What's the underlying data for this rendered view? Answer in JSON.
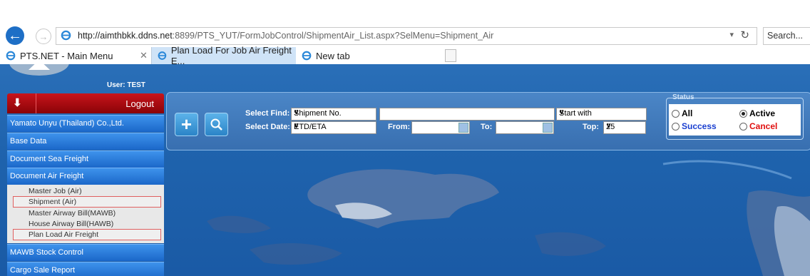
{
  "browser": {
    "url_host": "http://aimthbkk.ddns.net",
    "url_rest": ":8899/PTS_YUT/FormJobControl/ShipmentAir_List.aspx?SelMenu=Shipment_Air",
    "search_placeholder": "Search...",
    "tabs": [
      {
        "label": "PTS.NET - Main Menu"
      },
      {
        "label": "Plan Load For Job Air Freight E..."
      },
      {
        "label": "New tab"
      }
    ]
  },
  "header": {
    "user": "User: TEST"
  },
  "sidebar": {
    "logout": "Logout",
    "items": [
      {
        "label": "Yamato Unyu (Thailand) Co.,Ltd."
      },
      {
        "label": "Base Data"
      },
      {
        "label": "Document Sea Freight"
      },
      {
        "label": "Document Air Freight"
      }
    ],
    "subitems": [
      {
        "label": "Master Job (Air)"
      },
      {
        "label": "Shipment (Air)"
      },
      {
        "label": "Master Airway Bill(MAWB)"
      },
      {
        "label": "House Airway Bill(HAWB)"
      },
      {
        "label": "Plan Load Air Freight"
      }
    ],
    "items_after": [
      {
        "label": "MAWB Stock Control"
      },
      {
        "label": "Cargo Sale Report"
      }
    ]
  },
  "search": {
    "select_find_label": "Select Find:",
    "select_find_value": "Shipment No.",
    "match_value": "Start with",
    "select_date_label": "Select Date:",
    "select_date_value": "ETD/ETA",
    "from_label": "From:",
    "to_label": "To:",
    "top_label": "Top:",
    "top_value": "25"
  },
  "status": {
    "title": "Status",
    "options": [
      {
        "label": "All",
        "selected": false,
        "color": "#000000"
      },
      {
        "label": "Active",
        "selected": true,
        "color": "#000000"
      },
      {
        "label": "Success",
        "selected": false,
        "color": "#1a3fd0"
      },
      {
        "label": "Cancel",
        "selected": false,
        "color": "#e01010"
      }
    ]
  },
  "icons": {
    "back": "back-arrow-icon",
    "forward": "forward-arrow-icon",
    "refresh": "refresh-icon",
    "add": "plus-icon",
    "search": "magnifier-icon",
    "logout": "down-arrow-icon"
  }
}
